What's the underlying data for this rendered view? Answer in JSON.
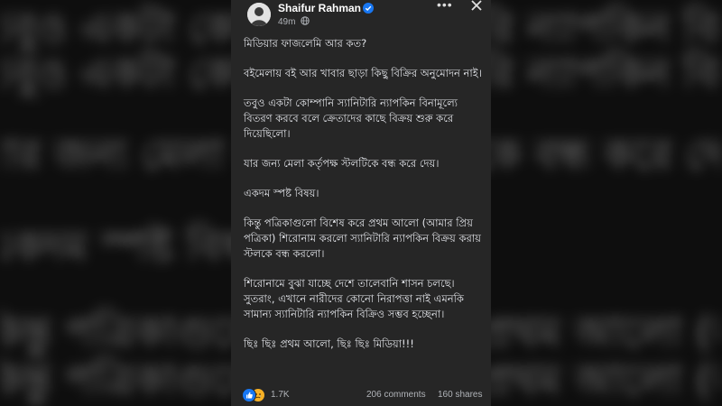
{
  "post": {
    "author": "Shaifur Rahman",
    "time": "49m",
    "paragraphs": [
      "মিডিয়ার ফাজলেমি আর কত?",
      "বইমেলায় বই আর খাবার ছাড়া কিছু বিক্রির অনুমোদন নাই।",
      "তবুও একটা কোম্পানি স্যানিটারি ন্যাপকিন বিনামূল্যে বিতরণ করবে বলে ক্রেতাদের কাছে বিক্রয় শুরু করে দিয়েছিলো।",
      "যার জন্য মেলা কর্তৃপক্ষ স্টলটিকে বন্ধ করে দেয়।",
      "একদম স্পষ্ট বিষয়।",
      "কিন্তু পত্রিকাগুলো বিশেষ করে প্রথম আলো (আমার প্রিয় পত্রিকা) শিরোনাম করলো স্যানিটারি ন্যাপকিন বিক্রয় করায় স্টলকে বন্ধ করলো।",
      "শিরোনামে বুঝা যাচ্ছে দেশে তালেবানি শাসন চলছে। সুতরাং, এখানে নারীদের কোনো নিরাপত্তা নাই এমনকি সামান্য স্যানিটারি ন্যাপকিন বিক্রিও সম্ভব হচ্ছেনা।",
      "ছিঃ ছিঃ প্রথম আলো, ছিঃ ছিঃ মিডিয়া!!!"
    ],
    "reactions_count": "1.7K",
    "comments_label": "206 comments",
    "shares_label": "160 shares"
  },
  "icons": {
    "more": "more-options-icon",
    "close": "close-icon",
    "verified": "verified-badge-icon",
    "audience": "globe-icon",
    "reaction_1": "like-reaction-icon",
    "reaction_2": "sad-reaction-icon"
  },
  "colors": {
    "card_bg": "#262626",
    "verified": "#1877f2",
    "like": "#1877f2",
    "sad": "#f7b125"
  }
}
